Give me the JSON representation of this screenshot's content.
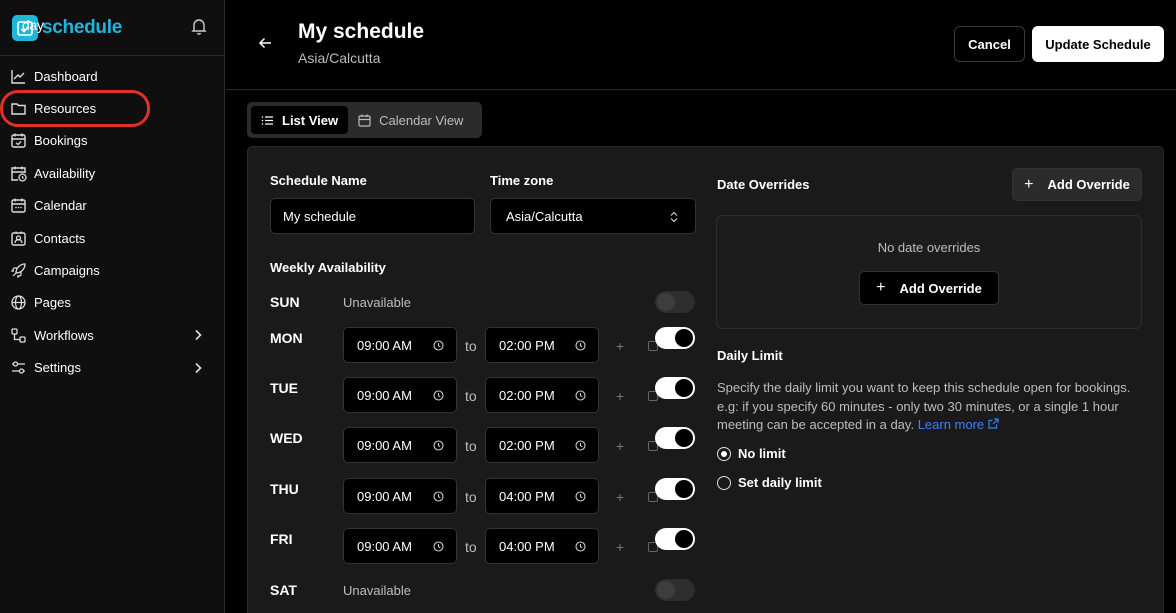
{
  "brand": {
    "logo_day": "day",
    "logo_schedule": "schedule"
  },
  "sidebar": {
    "items": [
      {
        "label": "Dashboard",
        "icon": "chart-line-icon"
      },
      {
        "label": "Resources",
        "icon": "folder-icon"
      },
      {
        "label": "Bookings",
        "icon": "calendar-check-icon"
      },
      {
        "label": "Availability",
        "icon": "calendar-clock-icon"
      },
      {
        "label": "Calendar",
        "icon": "calendar-icon"
      },
      {
        "label": "Contacts",
        "icon": "contact-icon"
      },
      {
        "label": "Campaigns",
        "icon": "rocket-icon"
      },
      {
        "label": "Pages",
        "icon": "globe-icon"
      },
      {
        "label": "Workflows",
        "icon": "workflow-icon"
      },
      {
        "label": "Settings",
        "icon": "settings-icon"
      }
    ]
  },
  "header": {
    "title": "My schedule",
    "subtitle": "Asia/Calcutta",
    "cancel_label": "Cancel",
    "update_label": "Update Schedule"
  },
  "view_tabs": {
    "list": "List View",
    "calendar": "Calendar View"
  },
  "form": {
    "schedule_name_label": "Schedule Name",
    "schedule_name_value": "My schedule",
    "timezone_label": "Time zone",
    "timezone_value": "Asia/Calcutta",
    "weekly_label": "Weekly Availability",
    "to_label": "to",
    "plus_label": "+",
    "unavailable_label": "Unavailable",
    "days": [
      {
        "day": "SUN",
        "enabled": false
      },
      {
        "day": "MON",
        "enabled": true,
        "start": "09:00 AM",
        "end": "02:00 PM"
      },
      {
        "day": "TUE",
        "enabled": true,
        "start": "09:00 AM",
        "end": "02:00 PM"
      },
      {
        "day": "WED",
        "enabled": true,
        "start": "09:00 AM",
        "end": "02:00 PM"
      },
      {
        "day": "THU",
        "enabled": true,
        "start": "09:00 AM",
        "end": "04:00 PM"
      },
      {
        "day": "FRI",
        "enabled": true,
        "start": "09:00 AM",
        "end": "04:00 PM"
      },
      {
        "day": "SAT",
        "enabled": false
      }
    ]
  },
  "overrides": {
    "title": "Date Overrides",
    "add_label": "Add Override",
    "empty_text": "No date overrides"
  },
  "daily_limit": {
    "title": "Daily Limit",
    "description": "Specify the daily limit you want to keep this schedule open for bookings. e.g: if you specify 60 minutes - only two 30 minutes, or a single 1 hour meeting can be accepted in a day.",
    "learn_more": "Learn more",
    "options": [
      "No limit",
      "Set daily limit"
    ],
    "selected": "No limit"
  },
  "colors": {
    "accent": "#1fb6d9",
    "link": "#3b82f6",
    "highlight": "#e0302a"
  }
}
